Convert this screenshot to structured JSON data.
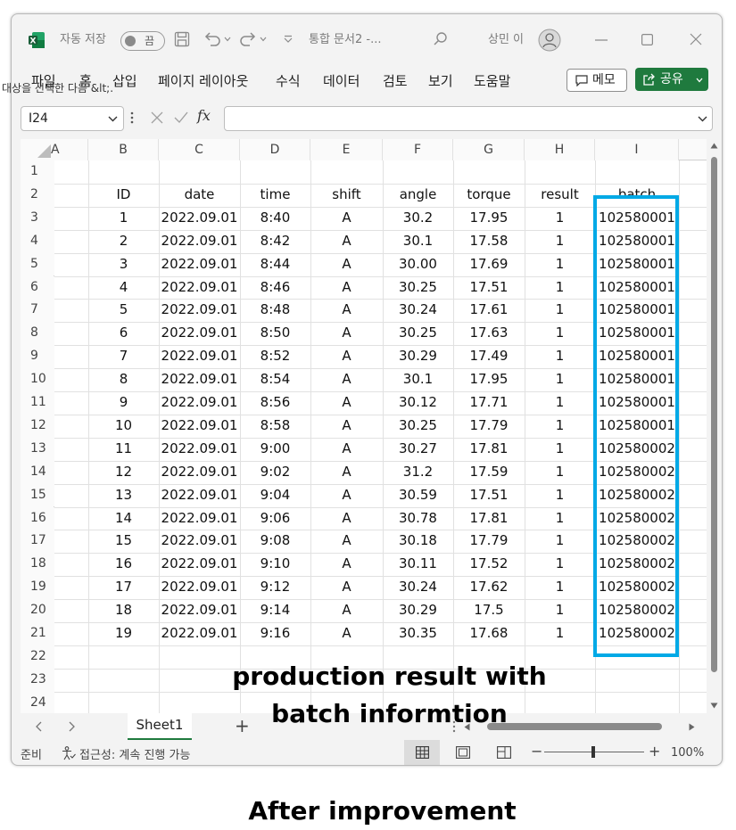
{
  "titlebar": {
    "autosave_label": "자동 저장",
    "autosave_state": "끔",
    "doc_title": "통합 문서2  -...",
    "user_name": "상민 이"
  },
  "ribbon": {
    "tabs": [
      "파일",
      "홈",
      "삽입",
      "페이지 레이아웃",
      "수식",
      "데이터",
      "검토",
      "보기",
      "도움말"
    ],
    "memo_label": "메모",
    "share_label": "공유"
  },
  "stray_text": "대상을 선택한 다음 &lt;.",
  "formula_bar": {
    "name_box": "I24",
    "fx_label": "fx",
    "formula_value": ""
  },
  "grid": {
    "partial_col": "A",
    "col_letters": [
      "B",
      "C",
      "D",
      "E",
      "F",
      "G",
      "H",
      "I"
    ],
    "row_numbers": [
      "1",
      "2",
      "3",
      "4",
      "5",
      "6",
      "7",
      "8",
      "9",
      "10",
      "11",
      "12",
      "13",
      "14",
      "15",
      "16",
      "17",
      "18",
      "19",
      "20",
      "21",
      "22",
      "23",
      "24"
    ],
    "headers": [
      "ID",
      "date",
      "time",
      "shift",
      "angle",
      "torque",
      "result",
      "batch"
    ],
    "rows": [
      [
        "1",
        "2022.09.01",
        "8:40",
        "A",
        "30.2",
        "17.95",
        "1",
        "102580001"
      ],
      [
        "2",
        "2022.09.01",
        "8:42",
        "A",
        "30.1",
        "17.58",
        "1",
        "102580001"
      ],
      [
        "3",
        "2022.09.01",
        "8:44",
        "A",
        "30.00",
        "17.69",
        "1",
        "102580001"
      ],
      [
        "4",
        "2022.09.01",
        "8:46",
        "A",
        "30.25",
        "17.51",
        "1",
        "102580001"
      ],
      [
        "5",
        "2022.09.01",
        "8:48",
        "A",
        "30.24",
        "17.61",
        "1",
        "102580001"
      ],
      [
        "6",
        "2022.09.01",
        "8:50",
        "A",
        "30.25",
        "17.63",
        "1",
        "102580001"
      ],
      [
        "7",
        "2022.09.01",
        "8:52",
        "A",
        "30.29",
        "17.49",
        "1",
        "102580001"
      ],
      [
        "8",
        "2022.09.01",
        "8:54",
        "A",
        "30.1",
        "17.95",
        "1",
        "102580001"
      ],
      [
        "9",
        "2022.09.01",
        "8:56",
        "A",
        "30.12",
        "17.71",
        "1",
        "102580001"
      ],
      [
        "10",
        "2022.09.01",
        "8:58",
        "A",
        "30.25",
        "17.79",
        "1",
        "102580001"
      ],
      [
        "11",
        "2022.09.01",
        "9:00",
        "A",
        "30.27",
        "17.81",
        "1",
        "102580002"
      ],
      [
        "12",
        "2022.09.01",
        "9:02",
        "A",
        "31.2",
        "17.59",
        "1",
        "102580002"
      ],
      [
        "13",
        "2022.09.01",
        "9:04",
        "A",
        "30.59",
        "17.51",
        "1",
        "102580002"
      ],
      [
        "14",
        "2022.09.01",
        "9:06",
        "A",
        "30.78",
        "17.81",
        "1",
        "102580002"
      ],
      [
        "15",
        "2022.09.01",
        "9:08",
        "A",
        "30.18",
        "17.79",
        "1",
        "102580002"
      ],
      [
        "16",
        "2022.09.01",
        "9:10",
        "A",
        "30.11",
        "17.52",
        "1",
        "102580002"
      ],
      [
        "17",
        "2022.09.01",
        "9:12",
        "A",
        "30.24",
        "17.62",
        "1",
        "102580002"
      ],
      [
        "18",
        "2022.09.01",
        "9:14",
        "A",
        "30.29",
        "17.5",
        "1",
        "102580002"
      ],
      [
        "19",
        "2022.09.01",
        "9:16",
        "A",
        "30.35",
        "17.68",
        "1",
        "102580002"
      ]
    ],
    "highlight_color": "#00a9e6"
  },
  "sheet_tabs": {
    "active": "Sheet1",
    "add_label": "+"
  },
  "statusbar": {
    "ready": "준비",
    "accessibility": "접근성: 계속 진행 가능",
    "zoom": "100%"
  },
  "annotations": {
    "overlay_line1": "production result with",
    "overlay_line2": "batch informtion",
    "caption": "After improvement"
  },
  "colors": {
    "excel_green": "#1f7a3e",
    "highlight_blue": "#00a9e6"
  }
}
